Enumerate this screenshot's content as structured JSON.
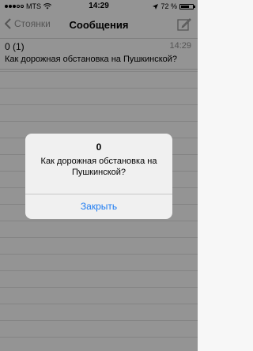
{
  "status_bar": {
    "carrier": "MTS",
    "time": "14:29",
    "battery_percent": "72 %",
    "battery_level": 0.72,
    "signal_bars": 3
  },
  "nav": {
    "back_label": "Стоянки",
    "title": "Сообщения",
    "compose_icon": "compose-icon"
  },
  "messages": [
    {
      "sender": "0 (1)",
      "time": "14:29",
      "preview": "Как дорожная обстановка на Пушкинской?"
    }
  ],
  "alert": {
    "title": "0",
    "message": "Как дорожная обстановка на Пушкинской?",
    "button_label": "Закрыть",
    "button_color": "#1e7cf2"
  }
}
